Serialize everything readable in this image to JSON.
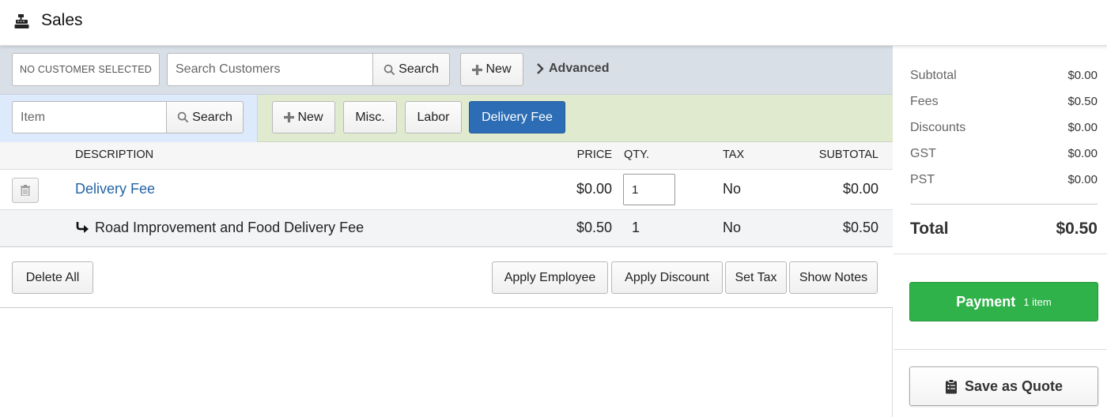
{
  "header": {
    "title": "Sales",
    "icon": "cash-register-icon"
  },
  "customer_bar": {
    "no_customer_label": "NO CUSTOMER SELECTED",
    "search_placeholder": "Search Customers",
    "search_button": "Search",
    "new_button": "New",
    "advanced_label": "Advanced"
  },
  "item_bar": {
    "item_placeholder": "Item",
    "search_button": "Search",
    "new_button": "New",
    "misc_button": "Misc.",
    "labor_button": "Labor",
    "delivery_fee_button": "Delivery Fee"
  },
  "table": {
    "columns": {
      "description": "DESCRIPTION",
      "price": "PRICE",
      "qty": "QTY.",
      "tax": "TAX",
      "subtotal": "SUBTOTAL"
    },
    "rows": [
      {
        "description": "Delivery Fee",
        "price": "$0.00",
        "qty": "1",
        "tax": "No",
        "subtotal": "$0.00"
      },
      {
        "description": "Road Improvement and Food Delivery Fee",
        "price": "$0.50",
        "qty": "1",
        "tax": "No",
        "subtotal": "$0.50"
      }
    ]
  },
  "actions": {
    "delete_all": "Delete All",
    "apply_employee": "Apply Employee",
    "apply_discount": "Apply Discount",
    "set_tax": "Set Tax",
    "show_notes": "Show Notes"
  },
  "summary": {
    "lines": [
      {
        "label": "Subtotal",
        "value": "$0.00"
      },
      {
        "label": "Fees",
        "value": "$0.50"
      },
      {
        "label": "Discounts",
        "value": "$0.00"
      },
      {
        "label": "GST",
        "value": "$0.00"
      },
      {
        "label": "PST",
        "value": "$0.00"
      }
    ],
    "total_label": "Total",
    "total_value": "$0.50",
    "payment_label": "Payment",
    "payment_count": "1 item",
    "save_quote_label": "Save as Quote"
  },
  "colors": {
    "primary": "#2d6db5",
    "payment": "#2fb24a",
    "link": "#2463a6"
  }
}
